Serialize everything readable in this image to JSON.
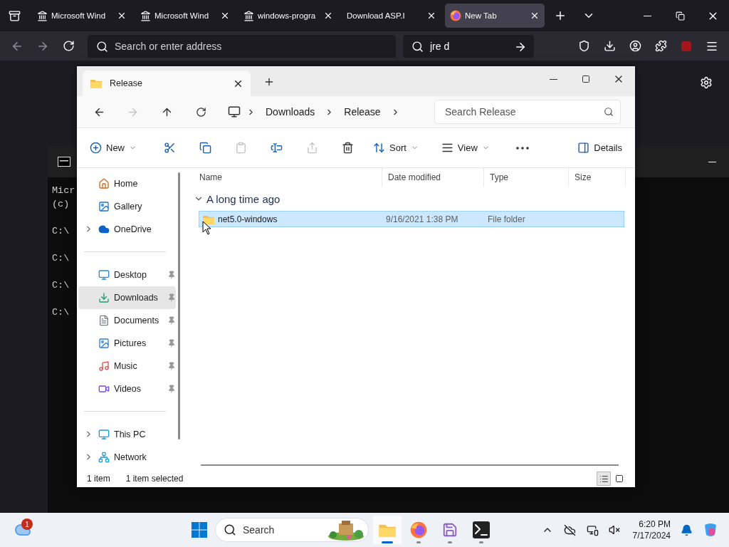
{
  "browser": {
    "tabs": [
      {
        "label": "Microsoft Wind",
        "kind": "landmark",
        "selected": false
      },
      {
        "label": "Microsoft Wind",
        "kind": "landmark",
        "selected": false
      },
      {
        "label": "windows-progra",
        "kind": "landmark",
        "selected": false
      },
      {
        "label": "Download ASP.I",
        "kind": "plain",
        "selected": false
      },
      {
        "label": "New Tab",
        "kind": "firefox",
        "selected": true
      }
    ],
    "address": {
      "placeholder": "Search or enter address"
    },
    "search": {
      "value": "jre d"
    }
  },
  "console": {
    "lines": [
      "Micr",
      "(c)",
      "C:\\",
      "C:\\",
      "C:\\",
      "C:\\"
    ]
  },
  "explorer": {
    "tab_title": "Release",
    "breadcrumb": [
      "Downloads",
      "Release"
    ],
    "search": {
      "placeholder": "Search Release"
    },
    "commands": [
      {
        "kind": "new",
        "label": "New",
        "dropdown": true,
        "disabled": false
      },
      {
        "kind": "cut",
        "disabled": false
      },
      {
        "kind": "copy",
        "disabled": false
      },
      {
        "kind": "paste",
        "disabled": true
      },
      {
        "kind": "rename",
        "disabled": false
      },
      {
        "kind": "share",
        "disabled": true
      },
      {
        "kind": "delete",
        "disabled": false
      },
      {
        "kind": "sort",
        "label": "Sort",
        "dropdown": true,
        "disabled": false
      },
      {
        "kind": "view",
        "label": "View",
        "dropdown": true,
        "disabled": false
      },
      {
        "kind": "more",
        "disabled": false
      }
    ],
    "details_button": {
      "label": "Details"
    },
    "sidebar": [
      {
        "items": [
          {
            "label": "Home",
            "kind": "home",
            "expandable": false,
            "pinned": false,
            "selected": false
          },
          {
            "label": "Gallery",
            "kind": "gallery",
            "expandable": false,
            "pinned": false,
            "selected": false
          },
          {
            "label": "OneDrive",
            "kind": "cloud",
            "expandable": true,
            "pinned": false,
            "selected": false
          }
        ]
      },
      {
        "items": [
          {
            "label": "Desktop",
            "kind": "desktop",
            "expandable": false,
            "pinned": true,
            "selected": false
          },
          {
            "label": "Downloads",
            "kind": "download",
            "expandable": false,
            "pinned": true,
            "selected": true
          },
          {
            "label": "Documents",
            "kind": "document",
            "expandable": false,
            "pinned": true,
            "selected": false
          },
          {
            "label": "Pictures",
            "kind": "pictures",
            "expandable": false,
            "pinned": true,
            "selected": false
          },
          {
            "label": "Music",
            "kind": "music",
            "expandable": false,
            "pinned": true,
            "selected": false
          },
          {
            "label": "Videos",
            "kind": "video",
            "expandable": false,
            "pinned": true,
            "selected": false
          }
        ]
      },
      {
        "items": [
          {
            "label": "This PC",
            "kind": "pc",
            "expandable": true,
            "pinned": false,
            "selected": false
          },
          {
            "label": "Network",
            "kind": "network",
            "expandable": true,
            "pinned": false,
            "selected": false
          }
        ]
      }
    ],
    "columns": [
      "Name",
      "Date modified",
      "Type",
      "Size"
    ],
    "group": {
      "label": "A long time ago",
      "expanded": true
    },
    "rows": [
      {
        "name": "net5.0-windows",
        "date": "9/16/2021 1:38 PM",
        "type": "File folder",
        "selected": true
      }
    ],
    "status": [
      "1 item",
      "1 item selected"
    ],
    "views": [
      {
        "kind": "details",
        "selected": true
      },
      {
        "kind": "tiles",
        "selected": false
      }
    ]
  },
  "taskbar": {
    "weather_badge": "1",
    "search": {
      "placeholder": "Search"
    },
    "apps": [
      {
        "kind": "explorer",
        "active": true
      },
      {
        "kind": "firefox",
        "active": false
      },
      {
        "kind": "app",
        "active": false
      },
      {
        "kind": "terminal",
        "active": false
      }
    ],
    "time": "6:20 PM",
    "date": "7/17/2024"
  }
}
